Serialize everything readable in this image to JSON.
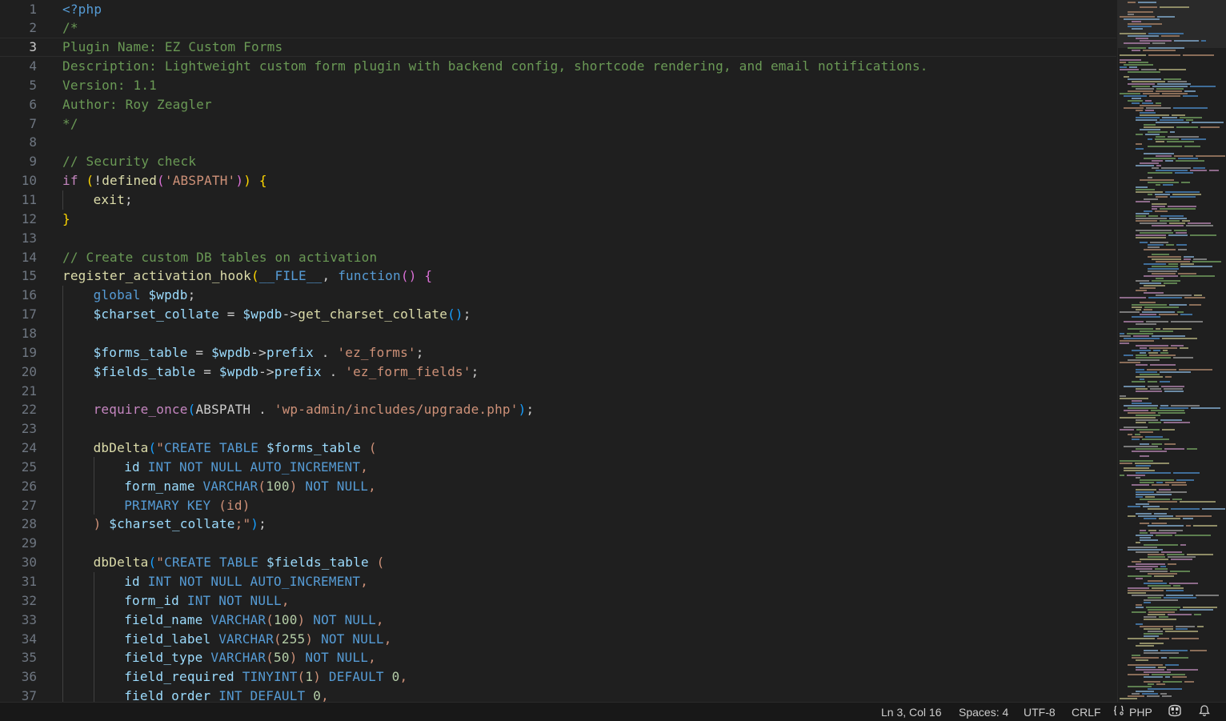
{
  "editor": {
    "language": "php",
    "current_line": 3,
    "lines": [
      {
        "n": "1",
        "indent": 0,
        "tokens": [
          [
            "tag",
            "<?php"
          ]
        ]
      },
      {
        "n": "2",
        "indent": 0,
        "tokens": [
          [
            "comment",
            "/*"
          ]
        ]
      },
      {
        "n": "3",
        "indent": 0,
        "tokens": [
          [
            "comment",
            "Plugin Name: EZ Custom Forms"
          ]
        ]
      },
      {
        "n": "4",
        "indent": 0,
        "tokens": [
          [
            "comment",
            "Description: Lightweight custom form plugin with backend config, shortcode rendering, and email notifications."
          ]
        ]
      },
      {
        "n": "5",
        "indent": 0,
        "tokens": [
          [
            "comment",
            "Version: 1.1"
          ]
        ]
      },
      {
        "n": "6",
        "indent": 0,
        "tokens": [
          [
            "comment",
            "Author: Roy Zeagler"
          ]
        ]
      },
      {
        "n": "7",
        "indent": 0,
        "tokens": [
          [
            "comment",
            "*/"
          ]
        ]
      },
      {
        "n": "8",
        "indent": 0,
        "tokens": []
      },
      {
        "n": "9",
        "indent": 0,
        "tokens": [
          [
            "comment",
            "// Security check"
          ]
        ]
      },
      {
        "n": "10",
        "indent": 0,
        "tokens": [
          [
            "control",
            "if"
          ],
          [
            "plain",
            " "
          ],
          [
            "paren1",
            "("
          ],
          [
            "plain",
            "!"
          ],
          [
            "func",
            "defined"
          ],
          [
            "paren2",
            "("
          ],
          [
            "string",
            "'ABSPATH'"
          ],
          [
            "paren2",
            ")"
          ],
          [
            "paren1",
            ")"
          ],
          [
            "plain",
            " "
          ],
          [
            "paren1",
            "{"
          ]
        ]
      },
      {
        "n": "11",
        "indent": 1,
        "tokens": [
          [
            "func",
            "exit"
          ],
          [
            "plain",
            ";"
          ]
        ]
      },
      {
        "n": "12",
        "indent": 0,
        "tokens": [
          [
            "paren1",
            "}"
          ]
        ]
      },
      {
        "n": "13",
        "indent": 0,
        "tokens": []
      },
      {
        "n": "14",
        "indent": 0,
        "tokens": [
          [
            "comment",
            "// Create custom DB tables on activation"
          ]
        ]
      },
      {
        "n": "15",
        "indent": 0,
        "tokens": [
          [
            "func",
            "register_activation_hook"
          ],
          [
            "paren1",
            "("
          ],
          [
            "const",
            "__FILE__"
          ],
          [
            "plain",
            ", "
          ],
          [
            "storage",
            "function"
          ],
          [
            "paren2",
            "()"
          ],
          [
            "plain",
            " "
          ],
          [
            "paren2",
            "{"
          ]
        ]
      },
      {
        "n": "16",
        "indent": 1,
        "tokens": [
          [
            "storage",
            "global"
          ],
          [
            "plain",
            " "
          ],
          [
            "var",
            "$wpdb"
          ],
          [
            "plain",
            ";"
          ]
        ]
      },
      {
        "n": "17",
        "indent": 1,
        "tokens": [
          [
            "var",
            "$charset_collate"
          ],
          [
            "plain",
            " = "
          ],
          [
            "var",
            "$wpdb"
          ],
          [
            "plain",
            "->"
          ],
          [
            "func",
            "get_charset_collate"
          ],
          [
            "paren3",
            "()"
          ],
          [
            "plain",
            ";"
          ]
        ]
      },
      {
        "n": "18",
        "indent": 1,
        "tokens": []
      },
      {
        "n": "19",
        "indent": 1,
        "tokens": [
          [
            "var",
            "$forms_table"
          ],
          [
            "plain",
            " = "
          ],
          [
            "var",
            "$wpdb"
          ],
          [
            "plain",
            "->"
          ],
          [
            "var",
            "prefix"
          ],
          [
            "plain",
            " . "
          ],
          [
            "string",
            "'ez_forms'"
          ],
          [
            "plain",
            ";"
          ]
        ]
      },
      {
        "n": "20",
        "indent": 1,
        "tokens": [
          [
            "var",
            "$fields_table"
          ],
          [
            "plain",
            " = "
          ],
          [
            "var",
            "$wpdb"
          ],
          [
            "plain",
            "->"
          ],
          [
            "var",
            "prefix"
          ],
          [
            "plain",
            " . "
          ],
          [
            "string",
            "'ez_form_fields'"
          ],
          [
            "plain",
            ";"
          ]
        ]
      },
      {
        "n": "21",
        "indent": 1,
        "tokens": []
      },
      {
        "n": "22",
        "indent": 1,
        "tokens": [
          [
            "keyword",
            "require_once"
          ],
          [
            "paren3",
            "("
          ],
          [
            "plain",
            "ABSPATH . "
          ],
          [
            "string",
            "'wp-admin/includes/upgrade.php'"
          ],
          [
            "paren3",
            ")"
          ],
          [
            "plain",
            ";"
          ]
        ]
      },
      {
        "n": "23",
        "indent": 1,
        "tokens": []
      },
      {
        "n": "24",
        "indent": 1,
        "tokens": [
          [
            "func",
            "dbDelta"
          ],
          [
            "paren3",
            "("
          ],
          [
            "string",
            "\""
          ],
          [
            "sql",
            "CREATE TABLE"
          ],
          [
            "plain",
            " "
          ],
          [
            "var",
            "$forms_table"
          ],
          [
            "plain",
            " "
          ],
          [
            "string",
            "("
          ]
        ]
      },
      {
        "n": "25",
        "indent": 2,
        "tokens": [
          [
            "var",
            "id"
          ],
          [
            "plain",
            " "
          ],
          [
            "sql",
            "INT NOT NULL AUTO_INCREMENT"
          ],
          [
            "string",
            ","
          ]
        ]
      },
      {
        "n": "26",
        "indent": 2,
        "tokens": [
          [
            "var",
            "form_name"
          ],
          [
            "plain",
            " "
          ],
          [
            "sql",
            "VARCHAR"
          ],
          [
            "string",
            "("
          ],
          [
            "number",
            "100"
          ],
          [
            "string",
            ")"
          ],
          [
            "plain",
            " "
          ],
          [
            "sql",
            "NOT NULL"
          ],
          [
            "string",
            ","
          ]
        ]
      },
      {
        "n": "27",
        "indent": 2,
        "tokens": [
          [
            "sql",
            "PRIMARY KEY"
          ],
          [
            "plain",
            " "
          ],
          [
            "string",
            "(id)"
          ]
        ]
      },
      {
        "n": "28",
        "indent": 1,
        "tokens": [
          [
            "string",
            ")"
          ],
          [
            "plain",
            " "
          ],
          [
            "var",
            "$charset_collate"
          ],
          [
            "string",
            ";\""
          ],
          [
            "paren3",
            ")"
          ],
          [
            "plain",
            ";"
          ]
        ]
      },
      {
        "n": "29",
        "indent": 1,
        "tokens": []
      },
      {
        "n": "30",
        "indent": 1,
        "tokens": [
          [
            "func",
            "dbDelta"
          ],
          [
            "paren3",
            "("
          ],
          [
            "string",
            "\""
          ],
          [
            "sql",
            "CREATE TABLE"
          ],
          [
            "plain",
            " "
          ],
          [
            "var",
            "$fields_table"
          ],
          [
            "plain",
            " "
          ],
          [
            "string",
            "("
          ]
        ]
      },
      {
        "n": "31",
        "indent": 2,
        "tokens": [
          [
            "var",
            "id"
          ],
          [
            "plain",
            " "
          ],
          [
            "sql",
            "INT NOT NULL AUTO_INCREMENT"
          ],
          [
            "string",
            ","
          ]
        ]
      },
      {
        "n": "32",
        "indent": 2,
        "tokens": [
          [
            "var",
            "form_id"
          ],
          [
            "plain",
            " "
          ],
          [
            "sql",
            "INT NOT NULL"
          ],
          [
            "string",
            ","
          ]
        ]
      },
      {
        "n": "33",
        "indent": 2,
        "tokens": [
          [
            "var",
            "field_name"
          ],
          [
            "plain",
            " "
          ],
          [
            "sql",
            "VARCHAR"
          ],
          [
            "string",
            "("
          ],
          [
            "number",
            "100"
          ],
          [
            "string",
            ")"
          ],
          [
            "plain",
            " "
          ],
          [
            "sql",
            "NOT NULL"
          ],
          [
            "string",
            ","
          ]
        ]
      },
      {
        "n": "34",
        "indent": 2,
        "tokens": [
          [
            "var",
            "field_label"
          ],
          [
            "plain",
            " "
          ],
          [
            "sql",
            "VARCHAR"
          ],
          [
            "string",
            "("
          ],
          [
            "number",
            "255"
          ],
          [
            "string",
            ")"
          ],
          [
            "plain",
            " "
          ],
          [
            "sql",
            "NOT NULL"
          ],
          [
            "string",
            ","
          ]
        ]
      },
      {
        "n": "35",
        "indent": 2,
        "tokens": [
          [
            "var",
            "field_type"
          ],
          [
            "plain",
            " "
          ],
          [
            "sql",
            "VARCHAR"
          ],
          [
            "string",
            "("
          ],
          [
            "number",
            "50"
          ],
          [
            "string",
            ")"
          ],
          [
            "plain",
            " "
          ],
          [
            "sql",
            "NOT NULL"
          ],
          [
            "string",
            ","
          ]
        ]
      },
      {
        "n": "36",
        "indent": 2,
        "tokens": [
          [
            "var",
            "field_required"
          ],
          [
            "plain",
            " "
          ],
          [
            "sql",
            "TINYINT"
          ],
          [
            "string",
            "("
          ],
          [
            "number",
            "1"
          ],
          [
            "string",
            ")"
          ],
          [
            "plain",
            " "
          ],
          [
            "sql",
            "DEFAULT"
          ],
          [
            "plain",
            " "
          ],
          [
            "number",
            "0"
          ],
          [
            "string",
            ","
          ]
        ]
      },
      {
        "n": "37",
        "indent": 2,
        "tokens": [
          [
            "var",
            "field_order"
          ],
          [
            "plain",
            " "
          ],
          [
            "sql",
            "INT DEFAULT"
          ],
          [
            "plain",
            " "
          ],
          [
            "number",
            "0"
          ],
          [
            "string",
            ","
          ]
        ]
      }
    ]
  },
  "status_bar": {
    "cursor_position": "Ln 3, Col 16",
    "indentation": "Spaces: 4",
    "encoding": "UTF-8",
    "line_ending": "CRLF",
    "language_mode": "PHP",
    "language_icon": "braces-icon",
    "copilot_icon": "copilot-icon",
    "notifications_icon": "bell-icon"
  },
  "colors": {
    "background": "#1f1f1f",
    "status_bar_bg": "#181818",
    "comment": "#6a9955",
    "keyword": "#c586c0",
    "string": "#ce9178",
    "function": "#dcdcaa",
    "variable": "#9cdcfe",
    "sql_keyword": "#569cd6",
    "number": "#b5cea8"
  }
}
